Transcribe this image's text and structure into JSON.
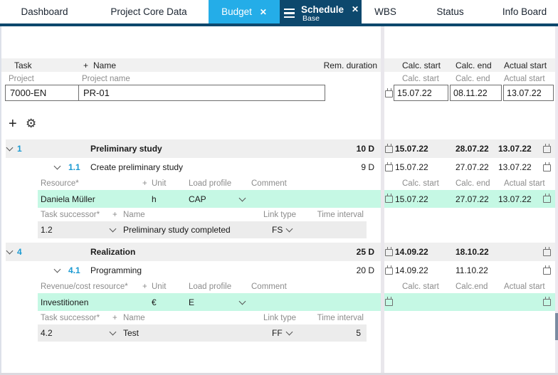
{
  "colors": {
    "accent_cyan": "#24ade8",
    "accent_navy": "#0d486d",
    "row_green": "#c5f8e4",
    "task_number_blue": "#1b9ad2"
  },
  "tabs": [
    {
      "label": "Dashboard"
    },
    {
      "label": "Project Core Data"
    },
    {
      "label": "Budget",
      "close": "✕"
    },
    {
      "label": "Schedule",
      "sublabel": "Base",
      "close": "✕"
    },
    {
      "label": "WBS"
    },
    {
      "label": "Status"
    },
    {
      "label": "Info Board"
    }
  ],
  "table_header": {
    "task": "Task",
    "plus": "+",
    "name": "Name",
    "rem_duration": "Rem. duration",
    "calc_start": "Calc. start",
    "calc_end": "Calc. end",
    "actual_start": "Actual start"
  },
  "project_row": {
    "label_project": "Project",
    "label_project_name": "Project name",
    "label_calc_start": "Calc. start",
    "label_calc_end": "Calc. end",
    "label_actual_start": "Actual start",
    "id": "7000-EN",
    "name": "PR-01",
    "calc_start": "15.07.22",
    "calc_end": "08.11.22",
    "actual_start": "13.07.22"
  },
  "groups": [
    {
      "summary": {
        "number": "1",
        "name": "Preliminary study",
        "duration": "10 D",
        "calc_start": "15.07.22",
        "calc_end": "28.07.22",
        "actual_start": "13.07.22"
      },
      "task": {
        "number": "1.1",
        "name": "Create preliminary study",
        "duration": "9 D",
        "calc_start": "15.07.22",
        "calc_end": "27.07.22",
        "actual_start": "13.07.22"
      },
      "resource_labels": {
        "name": "Resource*",
        "plus": "+",
        "unit": "Unit",
        "load": "Load profile",
        "comment": "Comment",
        "calc_start": "Calc. start",
        "calc_end": "Calc. end",
        "actual_start": "Actual start"
      },
      "resource": {
        "name": "Daniela Müller",
        "unit": "h",
        "load": "CAP",
        "comment": "",
        "calc_start": "15.07.22",
        "calc_end": "27.07.22",
        "actual_start": "13.07.22"
      },
      "successor_labels": {
        "id": "Task successor*",
        "plus": "+",
        "name": "Name",
        "link": "Link type",
        "interval": "Time interval"
      },
      "successor": {
        "id": "1.2",
        "name": "Preliminary study completed",
        "link": "FS",
        "interval": ""
      }
    },
    {
      "summary": {
        "number": "4",
        "name": "Realization",
        "duration": "25 D",
        "calc_start": "14.09.22",
        "calc_end": "18.10.22",
        "actual_start": ""
      },
      "task": {
        "number": "4.1",
        "name": "Programming",
        "duration": "20 D",
        "calc_start": "14.09.22",
        "calc_end": "11.10.22",
        "actual_start": ""
      },
      "resource_labels": {
        "name": "Revenue/cost resource*",
        "plus": "+",
        "unit": "Unit",
        "load": "Load profile",
        "comment": "Comment",
        "calc_start": "Calc. start",
        "calc_end": "Calc.end",
        "actual_start": "Actual start"
      },
      "resource": {
        "name": "Investitionen",
        "unit": "€",
        "load": "E",
        "comment": "",
        "calc_start": "",
        "calc_end": "",
        "actual_start": ""
      },
      "successor_labels": {
        "id": "Task successor*",
        "plus": "+",
        "name": "Name",
        "link": "Link type",
        "interval": "Time interval"
      },
      "successor": {
        "id": "4.2",
        "name": "Test",
        "link": "FF",
        "interval": "5"
      }
    }
  ]
}
